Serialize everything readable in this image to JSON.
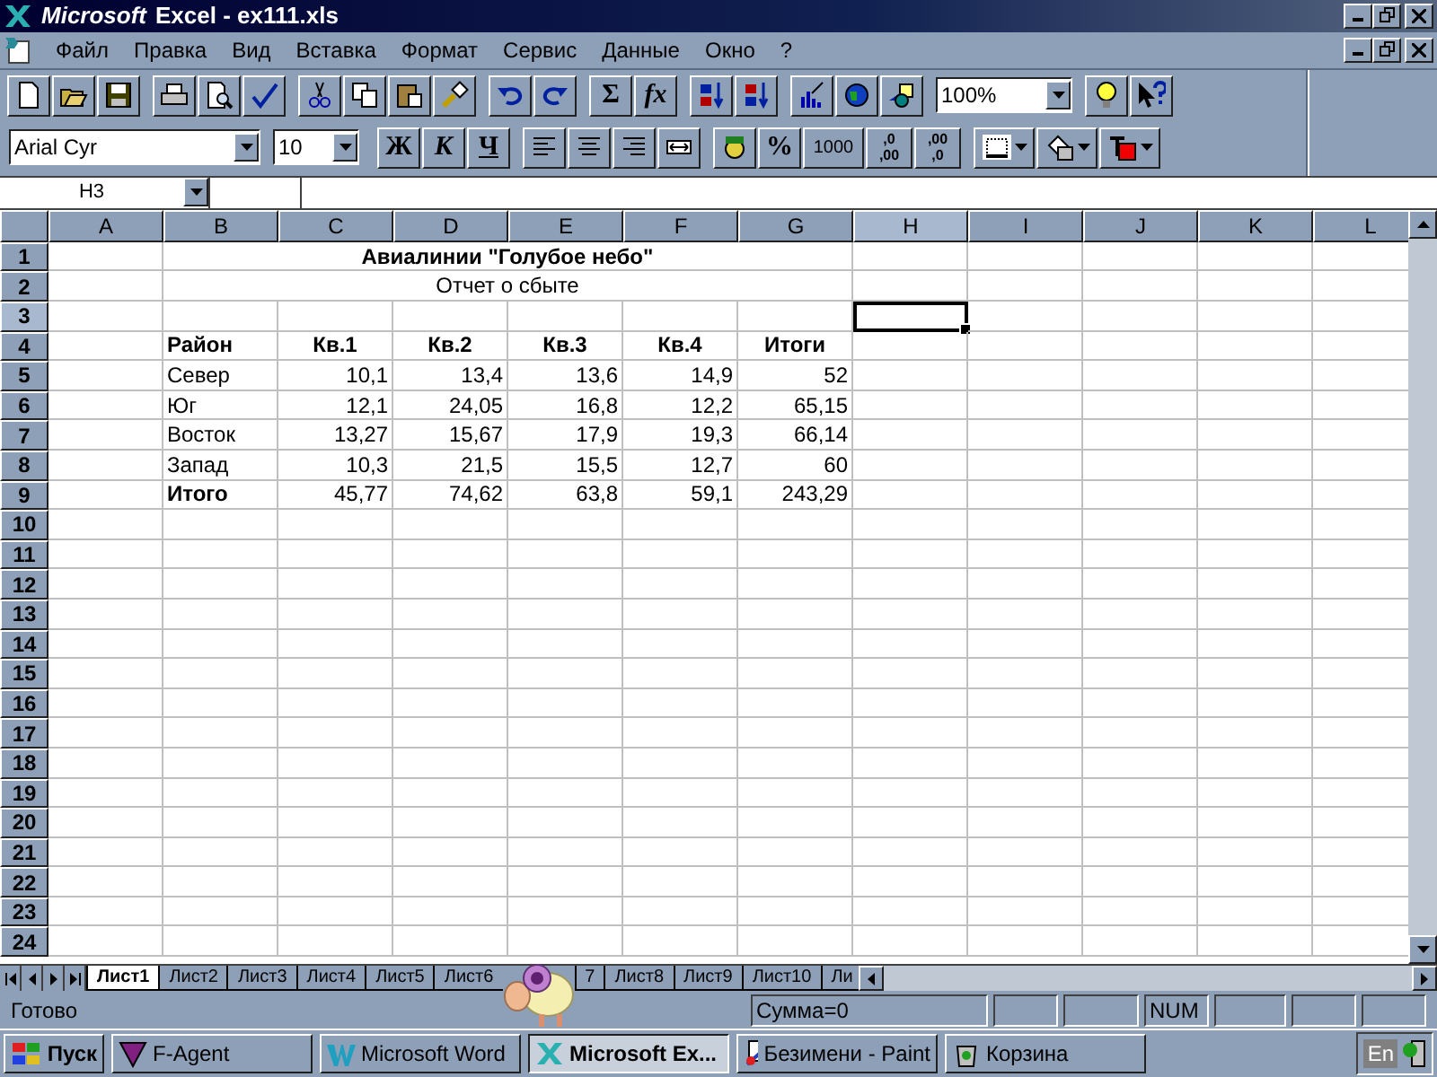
{
  "window": {
    "brand": "Microsoft",
    "title": "Excel - ex111.xls"
  },
  "menu": [
    "Файл",
    "Правка",
    "Вид",
    "Вставка",
    "Формат",
    "Сервис",
    "Данные",
    "Окно",
    "?"
  ],
  "toolbar": {
    "autosum": "Σ",
    "function": "fx",
    "zoom": "100%"
  },
  "formatting": {
    "font": "Arial Cyr",
    "size": "10",
    "bold": "Ж",
    "italic": "К",
    "underline": "Ч",
    "percent": "%",
    "thousands": "1000",
    "increase_decimal": {
      "top": ",0",
      "bottom": ",00"
    },
    "decrease_decimal": {
      "top": ",00",
      "bottom": ",0"
    }
  },
  "name_box": "H3",
  "sheet": {
    "columns": [
      {
        "letter": "A",
        "selected": false
      },
      {
        "letter": "B",
        "selected": false
      },
      {
        "letter": "C",
        "selected": false
      },
      {
        "letter": "D",
        "selected": false
      },
      {
        "letter": "E",
        "selected": false
      },
      {
        "letter": "F",
        "selected": false
      },
      {
        "letter": "G",
        "selected": false
      },
      {
        "letter": "H",
        "selected": true
      },
      {
        "letter": "I",
        "selected": false
      },
      {
        "letter": "J",
        "selected": false
      },
      {
        "letter": "K",
        "selected": false
      },
      {
        "letter": "L",
        "selected": false
      }
    ],
    "rows": [
      {
        "number": "1",
        "selected": false,
        "kind": "title",
        "text": "Авиалинии \"Голубое небо\"",
        "bold": true
      },
      {
        "number": "2",
        "selected": false,
        "kind": "title",
        "text": "Отчет о сбыте",
        "bold": false
      },
      {
        "number": "3",
        "selected": true
      },
      {
        "number": "4",
        "selected": false,
        "kind": "header",
        "label": "Район",
        "bold": true,
        "values": [
          "Кв.1",
          "Кв.2",
          "Кв.3",
          "Кв.4",
          "Итоги"
        ]
      },
      {
        "number": "5",
        "selected": false,
        "kind": "data",
        "label": "Север",
        "bold": false,
        "values": [
          "10,1",
          "13,4",
          "13,6",
          "14,9",
          "52"
        ]
      },
      {
        "number": "6",
        "selected": false,
        "kind": "data",
        "label": "Юг",
        "bold": false,
        "values": [
          "12,1",
          "24,05",
          "16,8",
          "12,2",
          "65,15"
        ]
      },
      {
        "number": "7",
        "selected": false,
        "kind": "data",
        "label": "Восток",
        "bold": false,
        "values": [
          "13,27",
          "15,67",
          "17,9",
          "19,3",
          "66,14"
        ]
      },
      {
        "number": "8",
        "selected": false,
        "kind": "data",
        "label": "Запад",
        "bold": false,
        "values": [
          "10,3",
          "21,5",
          "15,5",
          "12,7",
          "60"
        ]
      },
      {
        "number": "9",
        "selected": false,
        "kind": "data",
        "label": "Итого",
        "bold": true,
        "values": [
          "45,77",
          "74,62",
          "63,8",
          "59,1",
          "243,29"
        ]
      },
      {
        "number": "10",
        "selected": false
      },
      {
        "number": "11",
        "selected": false
      },
      {
        "number": "12",
        "selected": false
      },
      {
        "number": "13",
        "selected": false
      },
      {
        "number": "14",
        "selected": false
      },
      {
        "number": "15",
        "selected": false
      },
      {
        "number": "16",
        "selected": false
      },
      {
        "number": "17",
        "selected": false
      },
      {
        "number": "18",
        "selected": false
      },
      {
        "number": "19",
        "selected": false
      },
      {
        "number": "20",
        "selected": false
      },
      {
        "number": "21",
        "selected": false
      },
      {
        "number": "22",
        "selected": false
      },
      {
        "number": "23",
        "selected": false
      },
      {
        "number": "24",
        "selected": false
      }
    ]
  },
  "sheet_tabs": [
    {
      "label": "Лист1",
      "selected": true
    },
    {
      "label": "Лист2",
      "selected": false
    },
    {
      "label": "Лист3",
      "selected": false
    },
    {
      "label": "Лист4",
      "selected": false
    },
    {
      "label": "Лист5",
      "selected": false
    },
    {
      "label": "Лист6",
      "selected": false
    },
    {
      "label": "7",
      "selected": false
    },
    {
      "label": "Лист8",
      "selected": false
    },
    {
      "label": "Лист9",
      "selected": false
    },
    {
      "label": "Лист10",
      "selected": false
    },
    {
      "label": "Ли",
      "selected": false
    }
  ],
  "status_bar": {
    "state": "Готово",
    "sum": "Сумма=0",
    "num": "NUM"
  },
  "taskbar": {
    "start": "Пуск",
    "tasks": [
      {
        "label": "F-Agent",
        "selected": false
      },
      {
        "label": "Microsoft Word",
        "selected": false
      },
      {
        "label": "Microsoft Ex...",
        "selected": true
      },
      {
        "label": "Безимени - Paint",
        "selected": false
      },
      {
        "label": "Корзина",
        "selected": false
      }
    ],
    "language": "En"
  }
}
